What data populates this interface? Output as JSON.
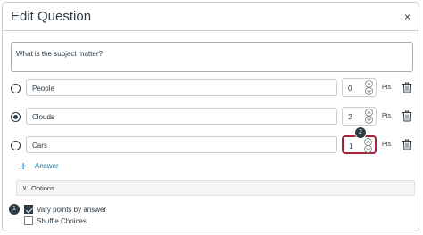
{
  "dialog": {
    "title": "Edit Question",
    "close_glyph": "×"
  },
  "question": {
    "text": "What is the subject matter?"
  },
  "answers": [
    {
      "text": "People",
      "points": "0",
      "selected": false
    },
    {
      "text": "Clouds",
      "points": "2",
      "selected": true
    },
    {
      "text": "Cars",
      "points": "1",
      "selected": false
    }
  ],
  "pts_label": "Pts",
  "add_answer": {
    "label": "Answer",
    "icon": "plus-icon"
  },
  "options": {
    "label": "Options",
    "icon": "chevron-down-icon"
  },
  "checkboxes": [
    {
      "label": "Vary points by answer",
      "checked": true
    },
    {
      "label": "Shuffle Choices",
      "checked": false
    }
  ],
  "callouts": {
    "one": "1",
    "two": "2"
  },
  "colors": {
    "accent": "#0770a3",
    "highlight": "#a4243b",
    "text": "#2d3b45"
  }
}
